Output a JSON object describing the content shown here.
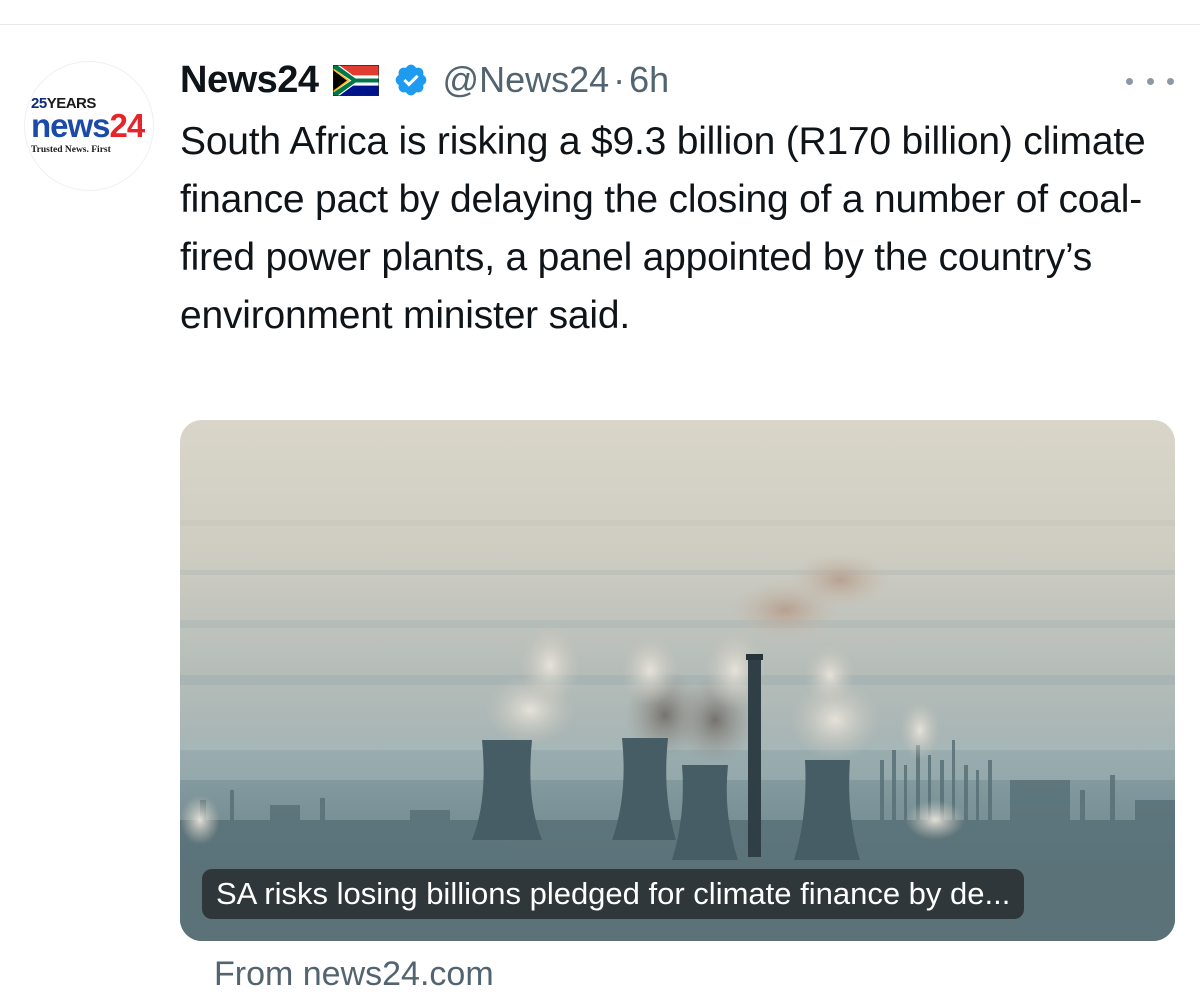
{
  "tweet": {
    "author": {
      "display_name": "News24",
      "flag_icon": "south-africa-flag-icon",
      "verified_icon": "verified-badge-icon",
      "handle": "@News24",
      "separator": "·",
      "time": "6h"
    },
    "avatar": {
      "logo_years_num": "25",
      "logo_years_word": "YEARS",
      "logo_word_1": "news",
      "logo_word_2": "24",
      "logo_tagline": "Trusted News. First"
    },
    "text": "South Africa is risking a $9.3 billion (R170 billion) climate finance pact by delaying the closing of a number of coal-fired power plants, a panel appointed by the country’s environment minister said.",
    "link_card": {
      "image_icon": "power-station-photo",
      "caption": "SA risks losing billions pledged for climate finance by de...",
      "source": "From news24.com"
    },
    "more_icon": "more-options-icon"
  },
  "colors": {
    "text_primary": "#0f1419",
    "text_secondary": "#536471",
    "verified_blue": "#1d9bf0",
    "logo_blue": "#1b4aa8",
    "logo_red": "#e5252b"
  }
}
